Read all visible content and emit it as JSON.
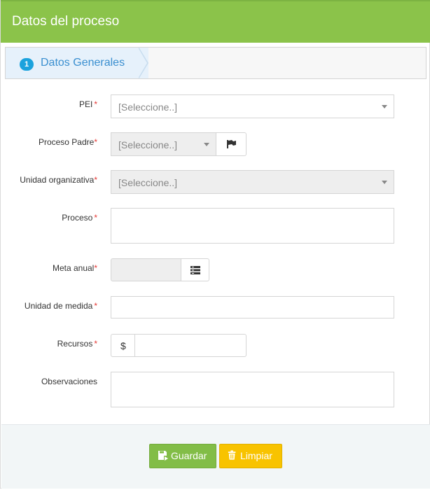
{
  "panel": {
    "title": "Datos del proceso"
  },
  "wizard": {
    "step_number": "1",
    "step_label": "Datos Generales"
  },
  "form": {
    "pei": {
      "label": "PEI",
      "placeholder": "[Seleccione..]"
    },
    "proceso_padre": {
      "label": "Proceso Padre",
      "placeholder": "[Seleccione..]"
    },
    "unidad_organizativa": {
      "label": "Unidad organizativa",
      "placeholder": "[Seleccione..]"
    },
    "proceso": {
      "label": "Proceso",
      "value": ""
    },
    "meta_anual": {
      "label": "Meta anual",
      "value": ""
    },
    "unidad_medida": {
      "label": "Unidad de medida",
      "value": ""
    },
    "recursos": {
      "label": "Recursos",
      "currency": "$",
      "value": ""
    },
    "observaciones": {
      "label": "Observaciones",
      "value": ""
    },
    "required_mark": "*"
  },
  "actions": {
    "save_label": "Guardar",
    "clear_label": "Limpiar"
  },
  "colors": {
    "header": "#8bc34a",
    "step_badge": "#1aa2dd",
    "save": "#82bd47",
    "clear": "#f8c300",
    "required": "#e53935"
  },
  "icons": {
    "flag": "flag-icon",
    "list": "list-icon",
    "save": "save-icon",
    "trash": "trash-icon"
  }
}
